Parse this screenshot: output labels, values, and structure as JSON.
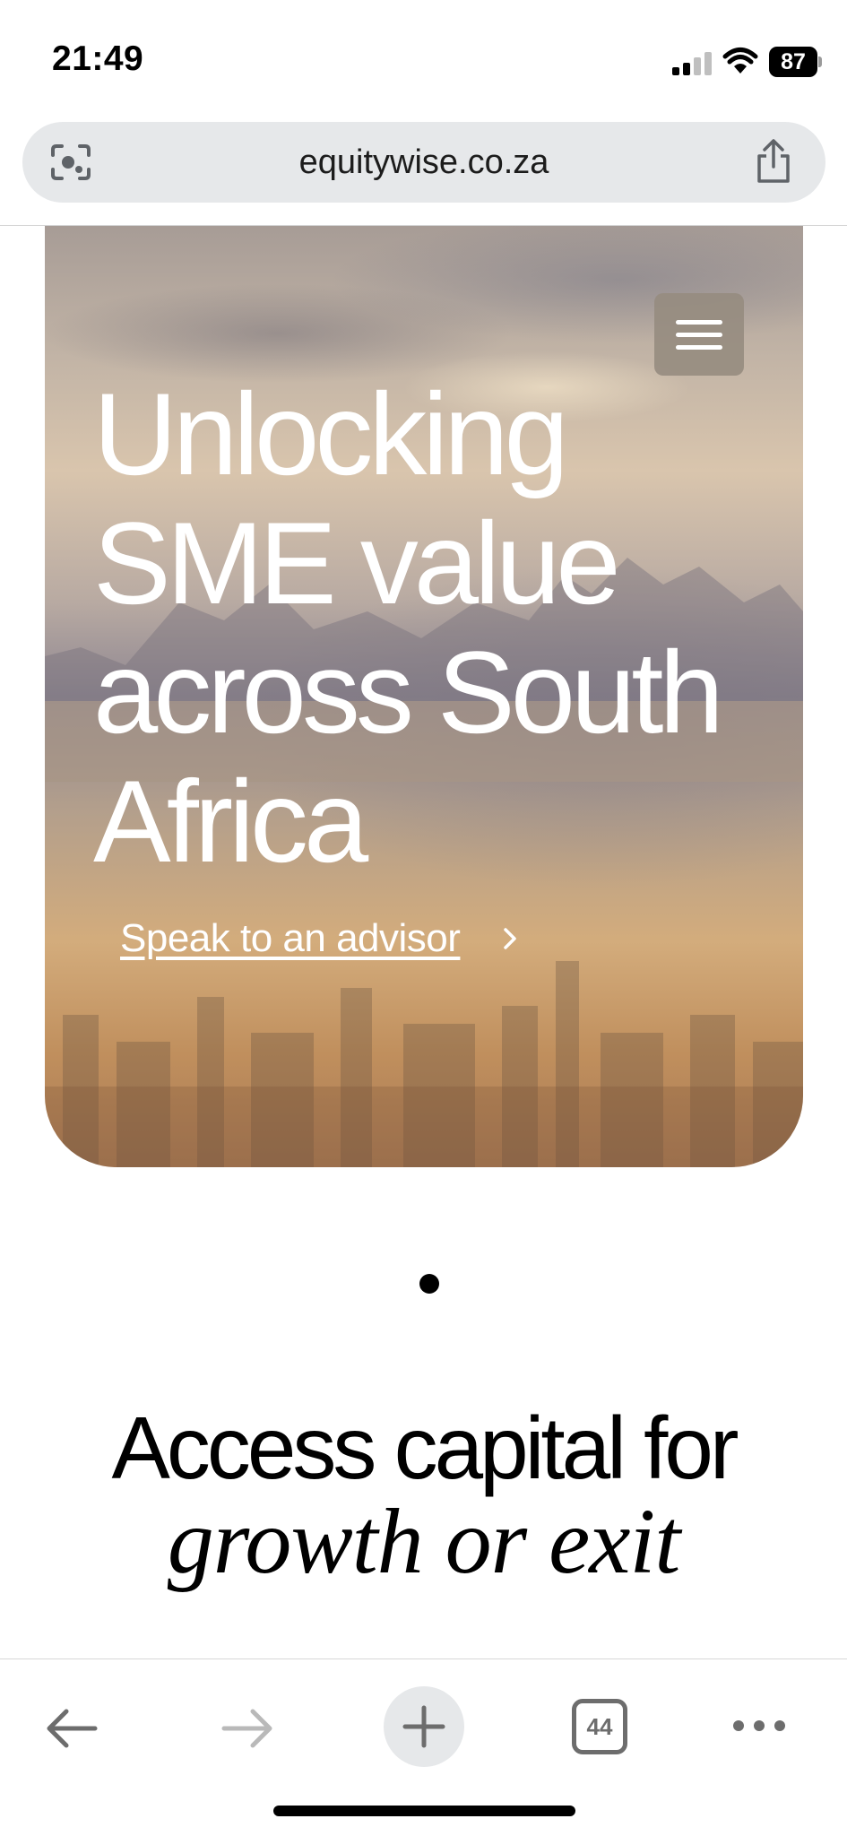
{
  "status_bar": {
    "time": "21:49",
    "battery": "87",
    "icons": [
      "signal-icon",
      "wifi-icon",
      "battery-icon"
    ]
  },
  "browser": {
    "url": "equitywise.co.za",
    "icons": [
      "visual-search-icon",
      "share-icon"
    ]
  },
  "hero": {
    "title_lines": [
      "Unlocking",
      "SME value",
      "across South",
      "Africa"
    ],
    "cta_label": "Speak to an advisor",
    "cta_icon": "chevron-right-icon",
    "menu_icon": "hamburger-menu-icon"
  },
  "carousel": {
    "active_index": 1,
    "total": 1
  },
  "section": {
    "title_line1": "Access capital for",
    "title_line2": "growth or exit"
  },
  "toolbar": {
    "tab_count": "44",
    "icons": [
      "back-arrow-icon",
      "forward-arrow-icon",
      "plus-icon",
      "tabs-icon",
      "more-icon"
    ]
  },
  "colors": {
    "url_bar_bg": "#e6e8ea",
    "toolbar_icon": "#6d6d6d",
    "forward_disabled": "#b9b9b9"
  }
}
